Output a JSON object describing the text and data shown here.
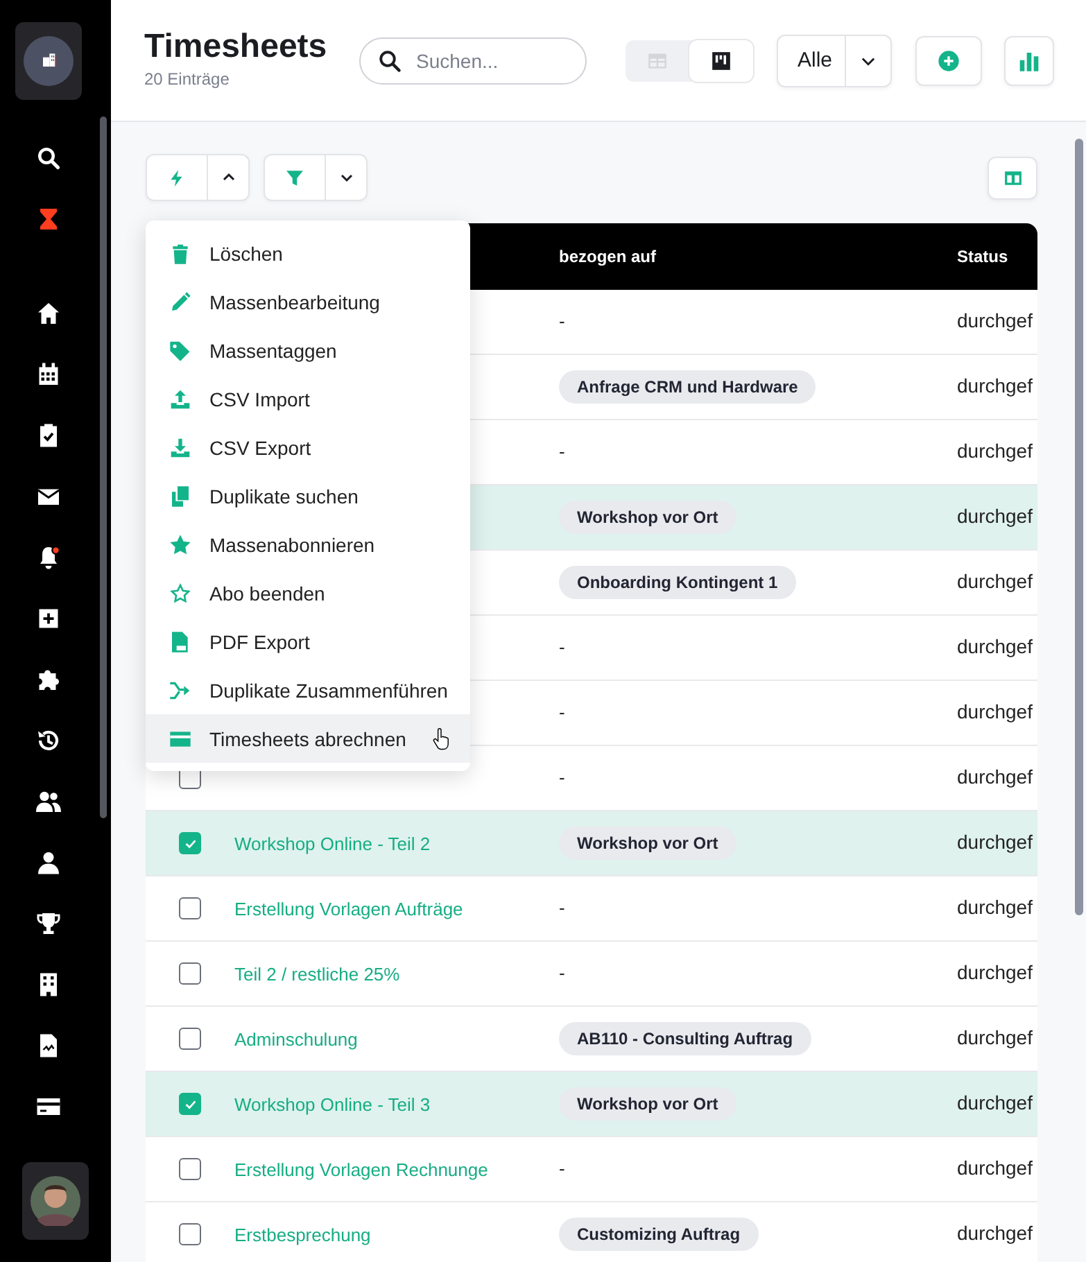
{
  "sidebar": {
    "items": [
      {
        "kind": "search"
      },
      {
        "kind": "timer"
      },
      {
        "kind": "home"
      },
      {
        "kind": "calendar"
      },
      {
        "kind": "clipboard"
      },
      {
        "kind": "mail"
      },
      {
        "kind": "bell",
        "alert": true
      },
      {
        "kind": "plus"
      },
      {
        "kind": "puzzle"
      },
      {
        "kind": "history"
      },
      {
        "kind": "users"
      },
      {
        "kind": "user"
      },
      {
        "kind": "trophy"
      },
      {
        "kind": "building"
      },
      {
        "kind": "file"
      },
      {
        "kind": "card"
      }
    ]
  },
  "header": {
    "title": "Timesheets",
    "subtitle": "20 Einträge",
    "search": {
      "placeholder": "Suchen..."
    },
    "view_toggle": [
      {
        "kind": "table",
        "selected": false
      },
      {
        "kind": "board",
        "selected": true
      }
    ],
    "filter_select": {
      "value": "Alle"
    }
  },
  "menu": {
    "items": [
      {
        "kind": "trash",
        "label": "Löschen",
        "hovered": false
      },
      {
        "kind": "pencil",
        "label": "Massenbearbeitung",
        "hovered": false
      },
      {
        "kind": "tag",
        "label": "Massentaggen",
        "hovered": false
      },
      {
        "kind": "upload",
        "label": "CSV Import",
        "hovered": false
      },
      {
        "kind": "download",
        "label": "CSV Export",
        "hovered": false
      },
      {
        "kind": "copy",
        "label": "Duplikate suchen",
        "hovered": false
      },
      {
        "kind": "star",
        "label": "Massenabonnieren",
        "hovered": false
      },
      {
        "kind": "star-outline",
        "label": "Abo beenden",
        "hovered": false
      },
      {
        "kind": "pdf",
        "label": "PDF Export",
        "hovered": false
      },
      {
        "kind": "merge",
        "label": "Duplikate Zusammenführen",
        "hovered": false
      },
      {
        "kind": "card",
        "label": "Timesheets abrechnen",
        "hovered": true
      }
    ]
  },
  "table": {
    "columns": [
      "bezogen auf",
      "Status"
    ],
    "rows": [
      {
        "selected": false,
        "related": {
          "kind": "none",
          "text": "-"
        },
        "status": "durchgef"
      },
      {
        "selected": false,
        "related": {
          "kind": "tag",
          "text": "Anfrage CRM und Hardware"
        },
        "status": "durchgef"
      },
      {
        "selected": false,
        "related": {
          "kind": "none",
          "text": "-"
        },
        "status": "durchgef"
      },
      {
        "selected": true,
        "related": {
          "kind": "tag",
          "text": "Workshop vor Ort"
        },
        "status": "durchgef"
      },
      {
        "selected": false,
        "related": {
          "kind": "tag",
          "text": "Onboarding Kontingent 1"
        },
        "status": "durchgef"
      },
      {
        "selected": false,
        "related": {
          "kind": "none",
          "text": "-"
        },
        "status": "durchgef"
      },
      {
        "selected": false,
        "related": {
          "kind": "none",
          "text": "-"
        },
        "status": "durchgef"
      },
      {
        "selected": false,
        "checked": false,
        "related": {
          "kind": "none",
          "text": "-"
        },
        "status": "durchgef"
      },
      {
        "selected": true,
        "checked": true,
        "title": "Workshop Online - Teil 2",
        "related": {
          "kind": "tag",
          "text": "Workshop vor Ort"
        },
        "status": "durchgef"
      },
      {
        "selected": false,
        "checked": false,
        "title": "Erstellung Vorlagen Aufträge",
        "related": {
          "kind": "none",
          "text": "-"
        },
        "status": "durchgef"
      },
      {
        "selected": false,
        "checked": false,
        "title": "Teil 2 / restliche 25%",
        "related": {
          "kind": "none",
          "text": "-"
        },
        "status": "durchgef"
      },
      {
        "selected": false,
        "checked": false,
        "title": "Adminschulung",
        "related": {
          "kind": "tag",
          "text": "AB110 - Consulting Auftrag"
        },
        "status": "durchgef"
      },
      {
        "selected": true,
        "checked": true,
        "title": "Workshop Online - Teil 3",
        "related": {
          "kind": "tag",
          "text": "Workshop vor Ort"
        },
        "status": "durchgef"
      },
      {
        "selected": false,
        "checked": false,
        "title": "Erstellung Vorlagen Rechnunge",
        "related": {
          "kind": "none",
          "text": "-"
        },
        "status": "durchgef"
      },
      {
        "selected": false,
        "checked": false,
        "title": "Erstbesprechung",
        "related": {
          "kind": "tag",
          "text": "Customizing Auftrag"
        },
        "status": "durchgef"
      }
    ]
  }
}
